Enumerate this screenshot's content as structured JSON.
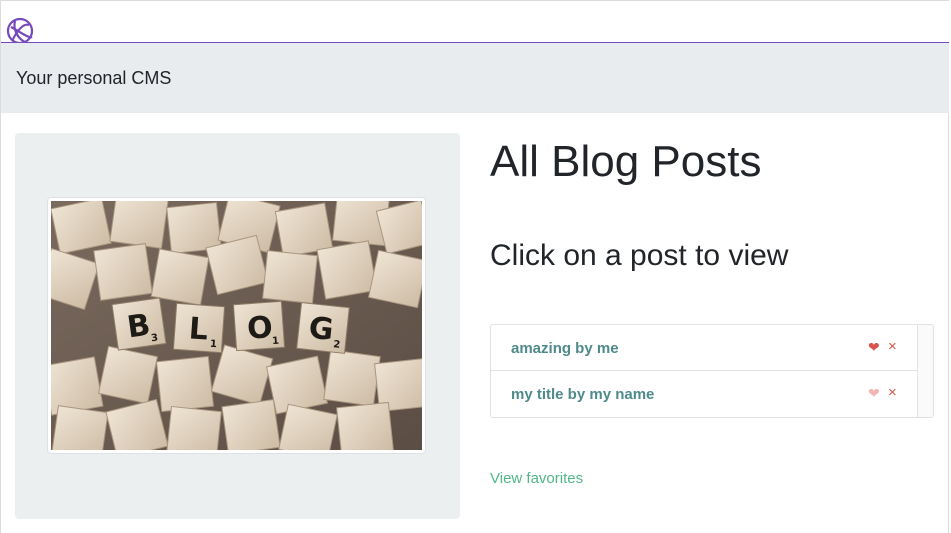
{
  "navbar": {
    "logo_icon": "redux-logo-icon",
    "accent_color": "#764abc"
  },
  "jumbotron": {
    "text": "Your personal CMS"
  },
  "hero_image": {
    "icon": "blog-scrabble-tiles-image",
    "tiles": [
      "B",
      "L",
      "O",
      "G"
    ],
    "tile_subscripts": [
      "3",
      "1",
      "1",
      "2"
    ]
  },
  "main": {
    "title": "All Blog Posts",
    "subtitle": "Click on a post to view"
  },
  "posts": [
    {
      "label": "amazing by me",
      "favorite": true,
      "heart_color": "#d9534f",
      "remove_label": "×"
    },
    {
      "label": "my title by my name",
      "favorite": false,
      "heart_color": "#f1b5b3",
      "remove_label": "×"
    }
  ],
  "favorites_link": "View favorites",
  "colors": {
    "post_link": "#4f8a8b",
    "favorites_link": "#52b788",
    "panel_bg": "#e9ecef"
  }
}
